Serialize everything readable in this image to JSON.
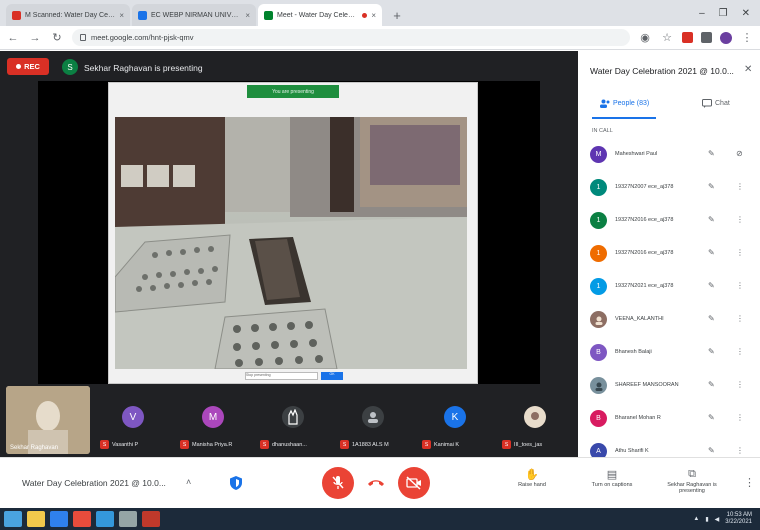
{
  "browser": {
    "tabs": [
      {
        "title": "M Scanned: Water Day Celebrati",
        "favicon_color": "#d93025",
        "active": false,
        "recording": false
      },
      {
        "title": "EC WEBP NIRMAN UNIVERS",
        "favicon_color": "#1a73e8",
        "active": false,
        "recording": false
      },
      {
        "title": "Meet - Water Day Celebrati",
        "favicon_color": "#00832d",
        "active": true,
        "recording": true
      }
    ],
    "close_symbol": "×",
    "new_tab_symbol": "+",
    "url": "meet.google.com/hnt-pjsk-qmv",
    "window_controls": [
      "–",
      "❐",
      "✕"
    ]
  },
  "stage": {
    "rec_label": "REC",
    "presenter_initial": "S",
    "presenting_text": "Sekhar Raghavan is presenting",
    "slide": {
      "banner_text": "You are presenting",
      "caption_placeholder": "Stop presenting",
      "caption_button": "OK"
    }
  },
  "thumbnails": {
    "self_name": "Sekhar Raghavan",
    "tiles": [
      {
        "initial": "V",
        "color": "#7e57c2",
        "name": "Vasanthi P"
      },
      {
        "initial": "M",
        "color": "#ab47bc",
        "name": "Manisha Priya.R"
      },
      {
        "initial": "",
        "color": "#3c4043",
        "name": "dhanushaan..."
      },
      {
        "initial": "",
        "color": "#3c4043",
        "name": "1A1883 ALS M"
      },
      {
        "initial": "K",
        "color": "#1a73e8",
        "name": "Kanimai K"
      },
      {
        "initial": "",
        "color": "#8d6e63",
        "name": "III_toes_jas"
      }
    ],
    "mic_letter": "S"
  },
  "controls": {
    "meeting_title": "Water Day Celebration 2021 @ 10.0...",
    "raise_hand": "Raise hand",
    "captions": "Turn on captions",
    "presenting": "Sekhar Raghavan is presenting",
    "more_symbol": "⋮",
    "chevron": "˄"
  },
  "panel": {
    "title": "Water Day Celebration 2021 @ 10.0...",
    "close_symbol": "✕",
    "tab_people": "People (83)",
    "tab_chat": "Chat",
    "section_label": "IN CALL",
    "participants": [
      {
        "name": "Maheshwari Paul",
        "initial": "M",
        "color": "#5e35b1"
      },
      {
        "name": "19327N2007 ece_aj378",
        "initial": "1",
        "color": "#00897b"
      },
      {
        "name": "19327N2016 ece_aj378",
        "initial": "1",
        "color": "#0b8043"
      },
      {
        "name": "19327N2016 ece_aj378",
        "initial": "1",
        "color": "#ef6c00"
      },
      {
        "name": "19327N2021 ece_aj378",
        "initial": "1",
        "color": "#039be5"
      },
      {
        "name": "VEENA_KALANTHI",
        "initial": "",
        "color": "#8d6e63"
      },
      {
        "name": "Bhanesh Balaji",
        "initial": "B",
        "color": "#7e57c2"
      },
      {
        "name": "SHAREEF MANSOORAN",
        "initial": "",
        "color": "#78909c"
      },
      {
        "name": "Bharanel Mohan R",
        "initial": "B",
        "color": "#d81b60"
      },
      {
        "name": "Athu Sharifi K",
        "initial": "A",
        "color": "#3949ab"
      }
    ],
    "mic_symbol": "🎙",
    "more_symbol": "⋮"
  },
  "taskbar": {
    "time": "10:53 AM",
    "date": "3/22/2021"
  }
}
